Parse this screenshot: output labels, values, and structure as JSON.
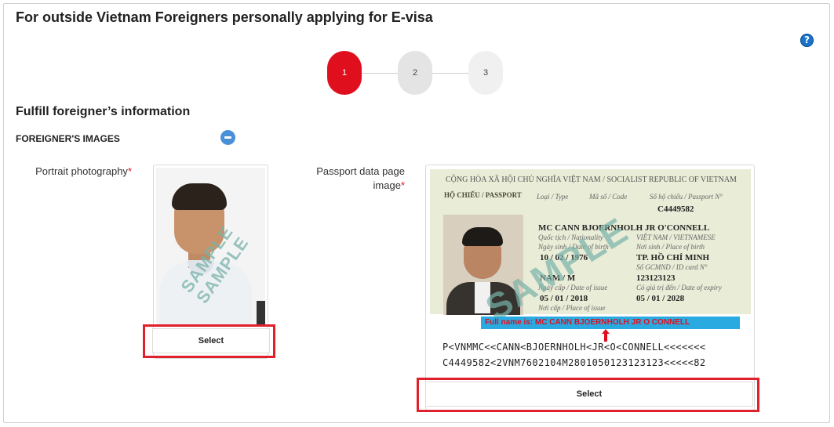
{
  "page": {
    "title": "For outside Vietnam Foreigners personally applying for E-visa",
    "help_icon": "?"
  },
  "stepper": {
    "steps": [
      "1",
      "2",
      "3"
    ],
    "active_step": 1,
    "colors": {
      "active": "#e00f1e",
      "inactive": "#e4e4e4"
    }
  },
  "section": {
    "title": "Fulfill foreigner’s information",
    "subtitle": "FOREIGNER'S IMAGES",
    "collapse_icon": "minus-circle-icon"
  },
  "portrait": {
    "label": "Portrait photography",
    "required_mark": "*",
    "watermark": [
      "SAMPLE",
      "SAMPLE"
    ],
    "select_label": "Select"
  },
  "passport": {
    "label": "Passport data page image",
    "required_mark": "*",
    "header": "CỘNG HÒA XÃ HỘI CHỦ NGHĨA VIỆT NAM / SOCIALIST REPUBLIC OF VIETNAM",
    "doc_type": "HỘ CHIẾU / PASSPORT",
    "fields": {
      "type_label": "Loại / Type",
      "code_label": "Mã số / Code",
      "passport_no_label": "Số hộ chiếu / Passport N°",
      "passport_no": "C4449582",
      "name": "MC CANN BJOERNHOLH JR O'CONNELL",
      "nationality_label": "Quốc tịch / Nationality",
      "nationality": "VIỆT NAM / VIETNAMESE",
      "dob_label": "Ngày sinh / Date of birth",
      "dob": "10 / 02 / 1976",
      "pob_label": "Nơi sinh / Place of birth",
      "pob": "TP. HỒ CHÍ MINH",
      "sex": "NAM / M",
      "id_label": "Số GCMND / ID card N°",
      "id_no": "123123123",
      "issue_label": "Ngày cấp / Date of issue",
      "issue": "05 / 01 / 2018",
      "expiry_label": "Có giá trị đến / Date of expiry",
      "expiry": "05 / 01 / 2028",
      "place_issue_label": "Nơi cấp / Place of issue"
    },
    "watermark": "SAMPLE",
    "fullname_note": "Full name is: MC CANN BJOERNHOLH JR O CONNELL",
    "mrz_line_1": "P<VNMMC<<CANN<BJOERNHOLH<JR<O<CONNELL<<<<<<<",
    "mrz_line_2": "C4449582<2VNM7602104M2801050123123123<<<<<82",
    "select_label": "Select"
  },
  "highlight_color": "#e0202b"
}
